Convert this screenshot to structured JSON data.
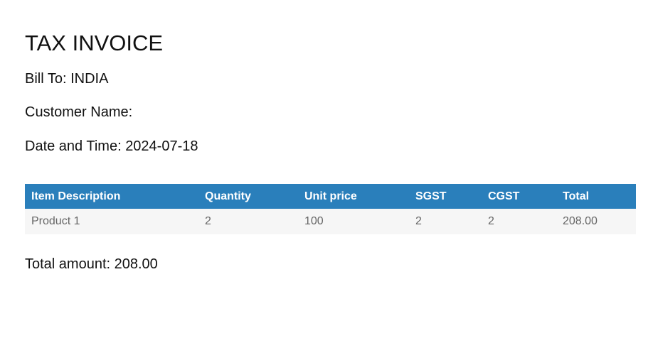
{
  "invoice": {
    "title": "TAX INVOICE",
    "bill_to_label": "Bill To: ",
    "bill_to_value": "INDIA",
    "customer_label": "Customer Name:",
    "customer_value": "",
    "date_label": "Date and Time: ",
    "date_value": "2024-07-18"
  },
  "table": {
    "headers": [
      "Item Description",
      "Quantity",
      "Unit price",
      "SGST",
      "CGST",
      "Total"
    ],
    "rows": [
      [
        "Product 1",
        "2",
        "100",
        "2",
        "2",
        "208.00"
      ]
    ]
  },
  "summary": {
    "total_label": "Total amount: ",
    "total_value": "208.00"
  },
  "colors": {
    "header_background": "#2a7fbb",
    "header_text": "#ffffff",
    "row_background": "#f6f6f6",
    "row_text": "#666666"
  }
}
